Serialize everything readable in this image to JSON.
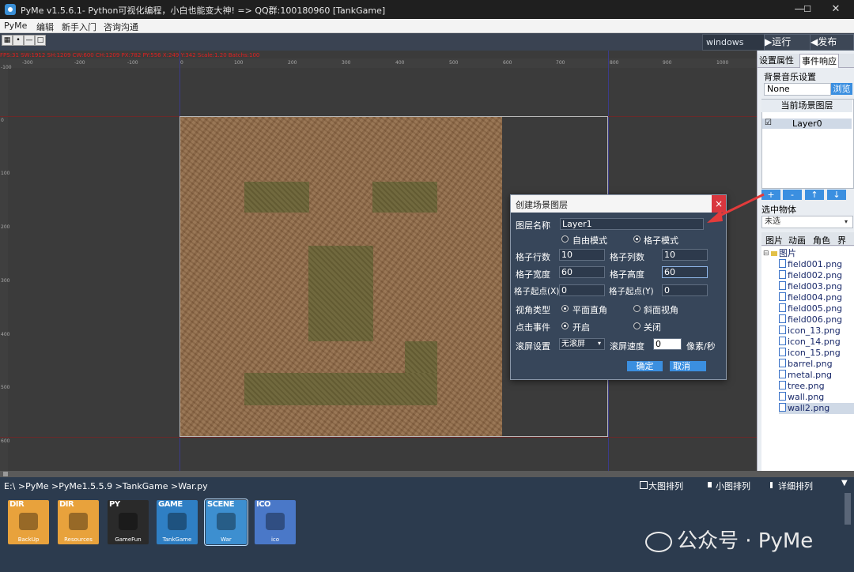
{
  "window": {
    "title": "PyMe v1.5.6.1- Python可视化编程，小白也能变大神!  => QQ群:100180960    [TankGame]",
    "minimize": "—",
    "maximize": "☐",
    "close": "✕"
  },
  "menu": [
    "PyMe",
    "编辑",
    "新手入门",
    "咨询沟通"
  ],
  "toolbar": {
    "platform": "windows",
    "run": "▶运行",
    "publish": "◀发布"
  },
  "canvas": {
    "status": "FPS:31 SW:1912 SH:1209 CW:600 CH:1209 PX:782 PY:556 X:249 Y:342 Scale:1.20 Batchs:100",
    "xticks": [
      "-300",
      "-200",
      "-100",
      "0",
      "100",
      "200",
      "300",
      "400",
      "500",
      "600",
      "700",
      "800",
      "900",
      "1000"
    ],
    "yticks": [
      "-100",
      "0",
      "100",
      "200",
      "300",
      "400",
      "500",
      "600"
    ]
  },
  "rightpanel": {
    "tabs": [
      "设置属性",
      "事件响应"
    ],
    "bgm_label": "背景音乐设置",
    "bgm_value": "None",
    "browse": "浏览",
    "layers_title": "当前场景图层",
    "layer_check": "☑",
    "layer_name": "Layer0",
    "layer_buttons": [
      "+",
      "-",
      "↑",
      "↓"
    ],
    "selected_label": "选中物体",
    "selected_value": "未选",
    "asset_tabs": [
      "图片",
      "动画",
      "角色",
      "界面"
    ],
    "tree_root": "图片",
    "files": [
      "field001.png",
      "field002.png",
      "field003.png",
      "field004.png",
      "field005.png",
      "field006.png",
      "icon_13.png",
      "icon_14.png",
      "icon_15.png",
      "barrel.png",
      "metal.png",
      "tree.png",
      "wall.png",
      "wall2.png"
    ]
  },
  "dialog": {
    "title": "创建场景图层",
    "close": "×",
    "layer_name_label": "图层名称",
    "layer_name_value": "Layer1",
    "mode_free": "自由模式",
    "mode_grid": "格子模式",
    "rows_label": "格子行数",
    "rows_value": "10",
    "cols_label": "格子列数",
    "cols_value": "10",
    "width_label": "格子宽度",
    "width_value": "60",
    "height_label": "格子高度",
    "height_value": "60",
    "startx_label": "格子起点(X)",
    "startx_value": "0",
    "starty_label": "格子起点(Y)",
    "starty_value": "0",
    "view_label": "视角类型",
    "view_flat": "平面直角",
    "view_iso": "斜面视角",
    "click_label": "点击事件",
    "click_on": "开启",
    "click_off": "关闭",
    "scroll_label": "滚屏设置",
    "scroll_value": "无滚屏",
    "speed_label": "滚屏速度",
    "speed_value": "0",
    "speed_unit": "像素/秒",
    "ok": "确定",
    "cancel": "取消"
  },
  "bottom": {
    "path": "E:\\ >PyMe >PyMe1.5.5.9 >TankGame >War.py",
    "view_large": "大图排列",
    "view_small": "小图排列",
    "view_detail": "详细排列",
    "thumbs": [
      {
        "tag": "DIR",
        "caption": "BackUp",
        "color": "#e8a23c"
      },
      {
        "tag": "DIR",
        "caption": "Resources",
        "color": "#e8a23c"
      },
      {
        "tag": "PY",
        "caption": "GameFun",
        "color": "#2a2a2a"
      },
      {
        "tag": "GAME",
        "caption": "TankGame",
        "color": "#2f7fc4"
      },
      {
        "tag": "SCENE",
        "caption": "War",
        "color": "#3d8fd0"
      },
      {
        "tag": "ICO",
        "caption": "ico",
        "color": "#4a78c8"
      }
    ]
  },
  "watermark": "公众号 · PyMe"
}
